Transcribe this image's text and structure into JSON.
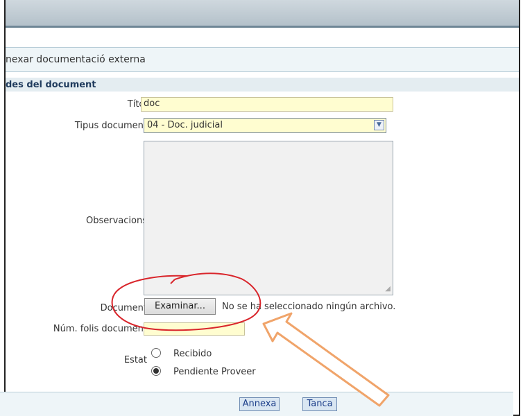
{
  "dialog": {
    "title": "nexar documentació externa",
    "section": "des del document"
  },
  "form": {
    "titol": {
      "label": "Títol",
      "value": "doc"
    },
    "tipus": {
      "label": "Tipus document",
      "value": "04 - Doc. judicial"
    },
    "observacions": {
      "label": "Observacions",
      "value": ""
    },
    "document": {
      "label": "Document",
      "button": "Examinar...",
      "status": "No se ha seleccionado ningún archivo."
    },
    "folis": {
      "label": "Núm. folis document",
      "value": ""
    },
    "estat": {
      "label": "Estat",
      "options": [
        {
          "label": "Recibido",
          "selected": false
        },
        {
          "label": "Pendiente Proveer",
          "selected": true
        }
      ]
    }
  },
  "buttons": {
    "annexa": "Annexa",
    "tanca": "Tanca"
  },
  "annotations": {
    "circle_color": "#d9252b",
    "arrow_color": "#f0a46a"
  }
}
